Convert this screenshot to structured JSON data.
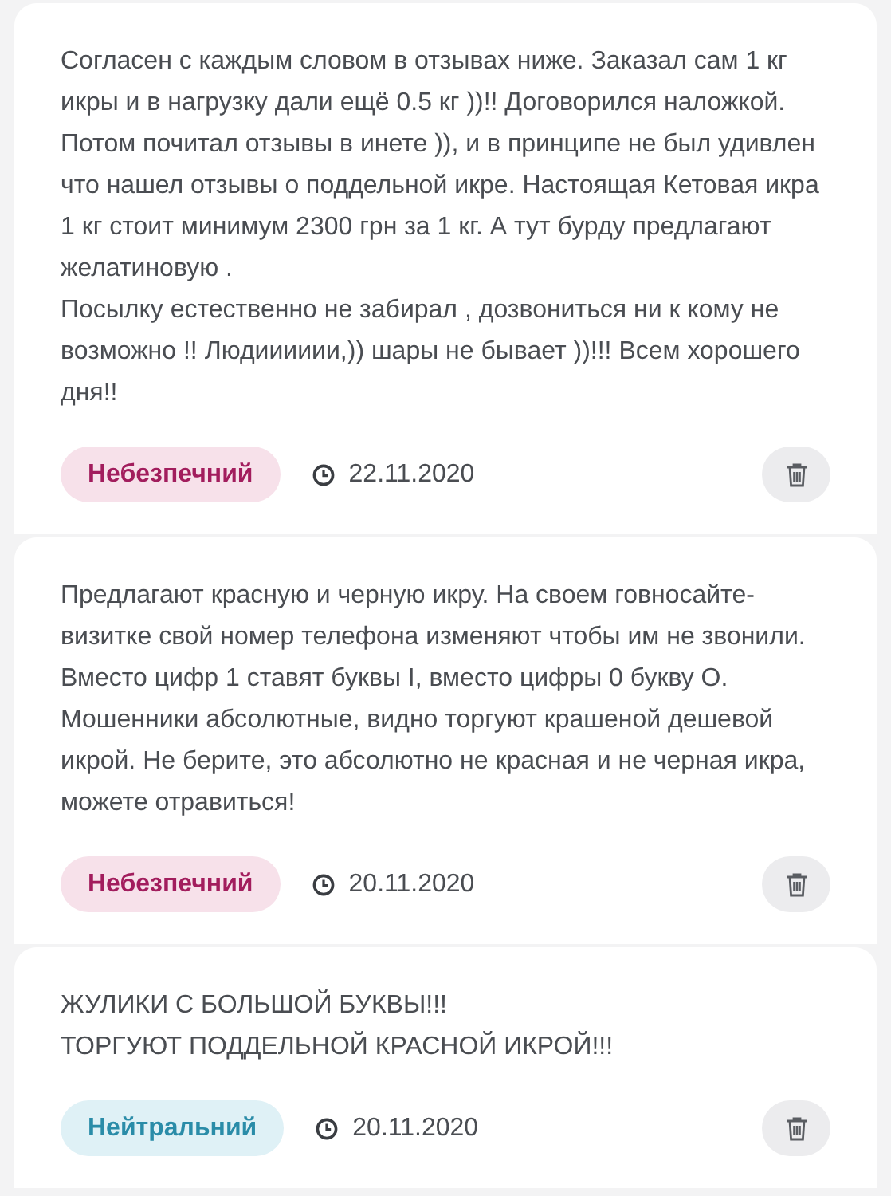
{
  "reviews": [
    {
      "text": "Согласен с каждым словом в отзывах ниже. Заказал сам 1 кг икры и в нагрузку дали ещё 0.5 кг ))!! Договорился наложкой. Потом почитал отзывы в инете )), и в принципе не был удивлен что нашел отзывы о поддельной икре. Настоящая Кетовая икра 1 кг стоит минимум 2300 грн за 1 кг. А тут бурду предлагают желатиновую .\nПосылку естественно не забирал , дозвониться ни к кому не возможно !! Людииииии,)) шары не бывает ))!!! Всем хорошего дня!!",
      "badge": {
        "kind": "danger",
        "label": "Небезпечний"
      },
      "date": "22.11.2020"
    },
    {
      "text": "Предлагают красную и черную икру. На своем говносайте-визитке свой номер телефона изменяют чтобы им не звонили. Вместо цифр 1 ставят буквы I, вместо цифры 0 букву О. Мошенники абсолютные, видно торгуют крашеной дешевой икрой. Не берите, это абсолютно не красная и не черная икра, можете отравиться!",
      "badge": {
        "kind": "danger",
        "label": "Небезпечний"
      },
      "date": "20.11.2020"
    },
    {
      "text": "ЖУЛИКИ С БОЛЬШОЙ БУКВЫ!!!\nТОРГУЮТ ПОДДЕЛЬНОЙ КРАСНОЙ ИКРОЙ!!!",
      "badge": {
        "kind": "neutral",
        "label": "Нейтральний"
      },
      "date": "20.11.2020"
    }
  ]
}
